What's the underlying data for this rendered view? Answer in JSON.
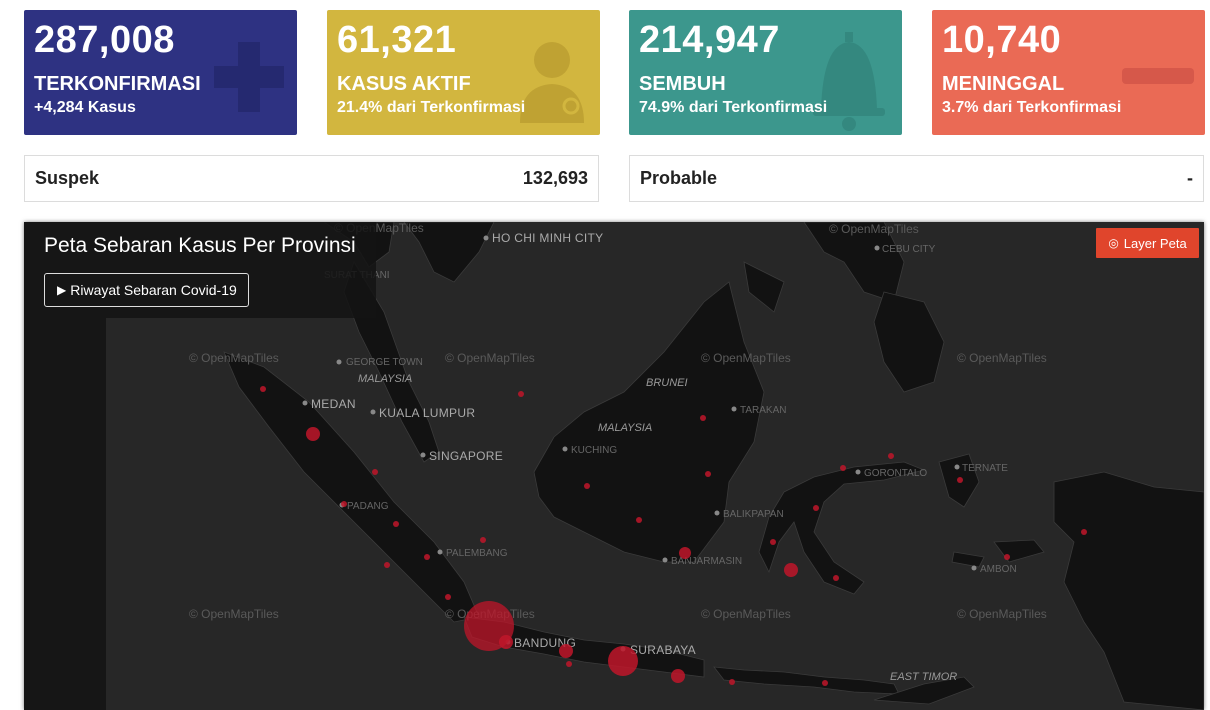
{
  "cards": [
    {
      "number": "287,008",
      "label": "TERKONFIRMASI",
      "sub": "+4,284 Kasus",
      "color": "#2e3282",
      "icon": "plus-icon"
    },
    {
      "number": "61,321",
      "label": "KASUS AKTIF",
      "sub": "21.4% dari Terkonfirmasi",
      "color": "#d2b63f",
      "icon": "doctor-icon"
    },
    {
      "number": "214,947",
      "label": "SEMBUH",
      "sub": "74.9% dari Terkonfirmasi",
      "color": "#3c978d",
      "icon": "bell-icon"
    },
    {
      "number": "10,740",
      "label": "MENINGGAL",
      "sub": "3.7% dari Terkonfirmasi",
      "color": "#ea6a55",
      "icon": "minus-icon"
    }
  ],
  "stats": [
    {
      "label": "Suspek",
      "value": "132,693"
    },
    {
      "label": "Probable",
      "value": "-"
    }
  ],
  "map": {
    "title": "Peta Sebaran Kasus Per Provinsi",
    "history_button": "Riwayat Sebaran Covid-19",
    "layer_button": "Layer Peta",
    "attribution": "© OpenMapTiles",
    "cities": [
      "HO CHI MINH CITY",
      "CEBU CITY",
      "SURAT THANI",
      "GEORGE TOWN",
      "MEDAN",
      "KUALA LUMPUR",
      "SINGAPORE",
      "PADANG",
      "PALEMBANG",
      "BANDUNG",
      "SURABAYA",
      "KUCHING",
      "TARAKAN",
      "BALIKPAPAN",
      "BANJARMASIN",
      "GORONTALO",
      "TERNATE",
      "AMBON",
      "EAST TIMOR"
    ],
    "countries": [
      "MALAYSIA",
      "BRUNEI",
      "MALAYSIA"
    ],
    "marker_color": "#c0162a"
  }
}
